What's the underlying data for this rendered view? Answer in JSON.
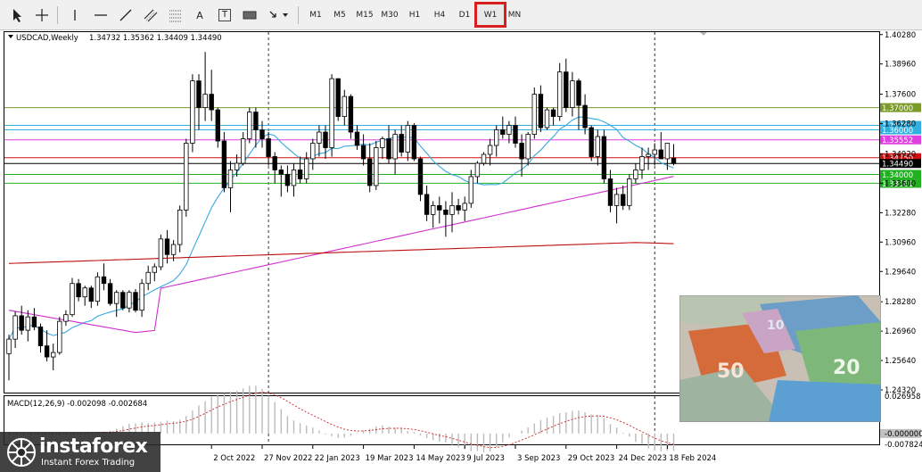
{
  "toolbar": {
    "timeframes": [
      "M1",
      "M5",
      "M15",
      "M30",
      "H1",
      "H4",
      "D1",
      "W1",
      "MN"
    ],
    "active_timeframe": "W1",
    "text_tool_label": "A",
    "label_tool_label": "T"
  },
  "chart_header": {
    "symbol": "USDCAD,Weekly",
    "ohlc": "1.34732 1.35362 1.34409 1.34490"
  },
  "macd_header": {
    "label": "MACD(12,26,9) -0.002098 -0.002684"
  },
  "logo": {
    "brand": "instaforex",
    "tagline": "Instant Forex Trading"
  },
  "colors": {
    "bull": "#ffffff",
    "bear": "#000000",
    "ma_fast": "#38a8e0",
    "ma_mid": "#d030d0",
    "ma_slow": "#c01010",
    "level_green": "#7a9a2a",
    "level_cyan": "#30b0e0",
    "level_magenta": "#e040e0",
    "level_red": "#d01010",
    "level_bright_green": "#20b020",
    "macd_hist": "#bbbbbb",
    "macd_signal": "#d02020",
    "highlight": "#d81e1e"
  },
  "chart_data": {
    "type": "candlestick",
    "symbol": "USDCAD",
    "timeframe": "Weekly",
    "ylim": [
      1.2416,
      1.4039
    ],
    "y_ticks": [
      "1.40280",
      "1.38960",
      "1.37600",
      "1.36280",
      "1.34920",
      "1.33600",
      "1.32280",
      "1.30960",
      "1.29640",
      "1.28280",
      "1.26960",
      "1.25640",
      "1.24320"
    ],
    "x_ticks": [
      "2 Oct 2022",
      "27 Nov 2022",
      "22 Jan 2023",
      "19 Mar 2023",
      "14 May 2023",
      "9 Jul 2023",
      "3 Sep 2023",
      "29 Oct 2023",
      "24 Dec 2023",
      "18 Feb 2024"
    ],
    "x_tick_index": [
      32,
      40,
      48,
      56,
      64,
      72,
      80,
      88,
      96,
      104
    ],
    "vlines_index": [
      41,
      102
    ],
    "levels": [
      {
        "value": 1.37,
        "label": "1.37000",
        "color": "#7a9a2a"
      },
      {
        "value": 1.362,
        "label": "1.36200",
        "color": "#30b0e0"
      },
      {
        "value": 1.36,
        "label": "1.36000",
        "color": "#30b0e0"
      },
      {
        "value": 1.35552,
        "label": "1.35552",
        "color": "#e040e0"
      },
      {
        "value": 1.3475,
        "label": "1.34750",
        "color": "#d01010"
      },
      {
        "value": 1.3449,
        "label": "1.34490",
        "color": "#000000"
      },
      {
        "value": 1.34,
        "label": "1.34000",
        "color": "#20b020"
      },
      {
        "value": 1.336,
        "label": "1.33581",
        "color": "#20b020"
      }
    ],
    "candles": [
      [
        1.2595,
        1.268,
        1.2475,
        1.266
      ],
      [
        1.266,
        1.2785,
        1.262,
        1.2765
      ],
      [
        1.2765,
        1.281,
        1.268,
        1.27
      ],
      [
        1.27,
        1.279,
        1.265,
        1.276
      ],
      [
        1.276,
        1.28,
        1.27,
        1.2715
      ],
      [
        1.2715,
        1.273,
        1.26,
        1.263
      ],
      [
        1.263,
        1.27,
        1.256,
        1.258
      ],
      [
        1.258,
        1.264,
        1.252,
        1.26
      ],
      [
        1.26,
        1.276,
        1.259,
        1.274
      ],
      [
        1.274,
        1.279,
        1.272,
        1.277
      ],
      [
        1.277,
        1.2935,
        1.276,
        1.291
      ],
      [
        1.291,
        1.293,
        1.283,
        1.285
      ],
      [
        1.285,
        1.29,
        1.281,
        1.289
      ],
      [
        1.289,
        1.29,
        1.28,
        1.283
      ],
      [
        1.283,
        1.296,
        1.281,
        1.294
      ],
      [
        1.294,
        1.3,
        1.288,
        1.291
      ],
      [
        1.291,
        1.293,
        1.281,
        1.282
      ],
      [
        1.282,
        1.288,
        1.276,
        1.287
      ],
      [
        1.287,
        1.288,
        1.279,
        1.28
      ],
      [
        1.28,
        1.288,
        1.278,
        1.287
      ],
      [
        1.287,
        1.2885,
        1.278,
        1.279
      ],
      [
        1.279,
        1.293,
        1.276,
        1.291
      ],
      [
        1.291,
        1.299,
        1.288,
        1.296
      ],
      [
        1.296,
        1.3,
        1.292,
        1.2985
      ],
      [
        1.2985,
        1.313,
        1.297,
        1.311
      ],
      [
        1.311,
        1.315,
        1.3,
        1.304
      ],
      [
        1.304,
        1.3105,
        1.301,
        1.3085
      ],
      [
        1.3085,
        1.326,
        1.305,
        1.324
      ],
      [
        1.324,
        1.356,
        1.321,
        1.354
      ],
      [
        1.354,
        1.385,
        1.35,
        1.382
      ],
      [
        1.382,
        1.385,
        1.36,
        1.37
      ],
      [
        1.37,
        1.395,
        1.364,
        1.376
      ],
      [
        1.376,
        1.387,
        1.364,
        1.369
      ],
      [
        1.369,
        1.37,
        1.352,
        1.355
      ],
      [
        1.355,
        1.359,
        1.332,
        1.334
      ],
      [
        1.334,
        1.346,
        1.323,
        1.342
      ],
      [
        1.342,
        1.349,
        1.339,
        1.345
      ],
      [
        1.345,
        1.359,
        1.344,
        1.356
      ],
      [
        1.356,
        1.37,
        1.354,
        1.368
      ],
      [
        1.368,
        1.37,
        1.352,
        1.36
      ],
      [
        1.36,
        1.364,
        1.352,
        1.356
      ],
      [
        1.356,
        1.359,
        1.344,
        1.348
      ],
      [
        1.348,
        1.35,
        1.336,
        1.342
      ],
      [
        1.342,
        1.344,
        1.33,
        1.34
      ],
      [
        1.34,
        1.344,
        1.332,
        1.335
      ],
      [
        1.335,
        1.345,
        1.33,
        1.342
      ],
      [
        1.342,
        1.348,
        1.336,
        1.338
      ],
      [
        1.338,
        1.35,
        1.336,
        1.347
      ],
      [
        1.347,
        1.356,
        1.342,
        1.354
      ],
      [
        1.354,
        1.362,
        1.348,
        1.359
      ],
      [
        1.359,
        1.362,
        1.347,
        1.352
      ],
      [
        1.352,
        1.385,
        1.348,
        1.383
      ],
      [
        1.383,
        1.383,
        1.364,
        1.366
      ],
      [
        1.366,
        1.378,
        1.362,
        1.375
      ],
      [
        1.375,
        1.376,
        1.356,
        1.359
      ],
      [
        1.359,
        1.362,
        1.351,
        1.353
      ],
      [
        1.353,
        1.358,
        1.344,
        1.347
      ],
      [
        1.347,
        1.354,
        1.332,
        1.335
      ],
      [
        1.335,
        1.355,
        1.333,
        1.352
      ],
      [
        1.352,
        1.357,
        1.347,
        1.356
      ],
      [
        1.356,
        1.362,
        1.345,
        1.347
      ],
      [
        1.347,
        1.36,
        1.34,
        1.358
      ],
      [
        1.358,
        1.362,
        1.348,
        1.35
      ],
      [
        1.35,
        1.364,
        1.346,
        1.362
      ],
      [
        1.362,
        1.363,
        1.346,
        1.347
      ],
      [
        1.347,
        1.348,
        1.328,
        1.331
      ],
      [
        1.331,
        1.335,
        1.319,
        1.322
      ],
      [
        1.322,
        1.328,
        1.316,
        1.326
      ],
      [
        1.326,
        1.33,
        1.318,
        1.324
      ],
      [
        1.324,
        1.328,
        1.312,
        1.322
      ],
      [
        1.322,
        1.332,
        1.314,
        1.326
      ],
      [
        1.326,
        1.329,
        1.322,
        1.324
      ],
      [
        1.324,
        1.33,
        1.319,
        1.327
      ],
      [
        1.327,
        1.342,
        1.325,
        1.339
      ],
      [
        1.339,
        1.346,
        1.336,
        1.345
      ],
      [
        1.345,
        1.35,
        1.344,
        1.349
      ],
      [
        1.349,
        1.356,
        1.344,
        1.353
      ],
      [
        1.353,
        1.362,
        1.348,
        1.36
      ],
      [
        1.36,
        1.366,
        1.356,
        1.358
      ],
      [
        1.358,
        1.364,
        1.354,
        1.362
      ],
      [
        1.362,
        1.366,
        1.352,
        1.354
      ],
      [
        1.354,
        1.358,
        1.339,
        1.347
      ],
      [
        1.347,
        1.359,
        1.344,
        1.358
      ],
      [
        1.358,
        1.379,
        1.356,
        1.376
      ],
      [
        1.376,
        1.38,
        1.359,
        1.361
      ],
      [
        1.361,
        1.37,
        1.36,
        1.369
      ],
      [
        1.369,
        1.37,
        1.362,
        1.366
      ],
      [
        1.366,
        1.39,
        1.364,
        1.386
      ],
      [
        1.386,
        1.392,
        1.368,
        1.37
      ],
      [
        1.37,
        1.386,
        1.366,
        1.382
      ],
      [
        1.382,
        1.383,
        1.36,
        1.371
      ],
      [
        1.371,
        1.376,
        1.358,
        1.361
      ],
      [
        1.361,
        1.362,
        1.346,
        1.348
      ],
      [
        1.348,
        1.36,
        1.344,
        1.357
      ],
      [
        1.357,
        1.36,
        1.336,
        1.338
      ],
      [
        1.338,
        1.342,
        1.323,
        1.326
      ],
      [
        1.326,
        1.334,
        1.318,
        1.331
      ],
      [
        1.331,
        1.335,
        1.324,
        1.326
      ],
      [
        1.326,
        1.34,
        1.324,
        1.338
      ],
      [
        1.338,
        1.345,
        1.336,
        1.342
      ],
      [
        1.342,
        1.352,
        1.338,
        1.348
      ],
      [
        1.348,
        1.352,
        1.342,
        1.349
      ],
      [
        1.349,
        1.354,
        1.344,
        1.351
      ],
      [
        1.351,
        1.359,
        1.347,
        1.347
      ],
      [
        1.347,
        1.354,
        1.342,
        1.354
      ],
      [
        1.3473,
        1.3536,
        1.3441,
        1.3449
      ]
    ],
    "macd": {
      "label": "MACD(12,26,9)",
      "ylim": [
        -0.00782,
        0.02695
      ],
      "y_ticks": [
        "0.026958",
        "-0.000000",
        "-0.007824"
      ],
      "main": -0.002098,
      "signal": -0.002684
    }
  }
}
